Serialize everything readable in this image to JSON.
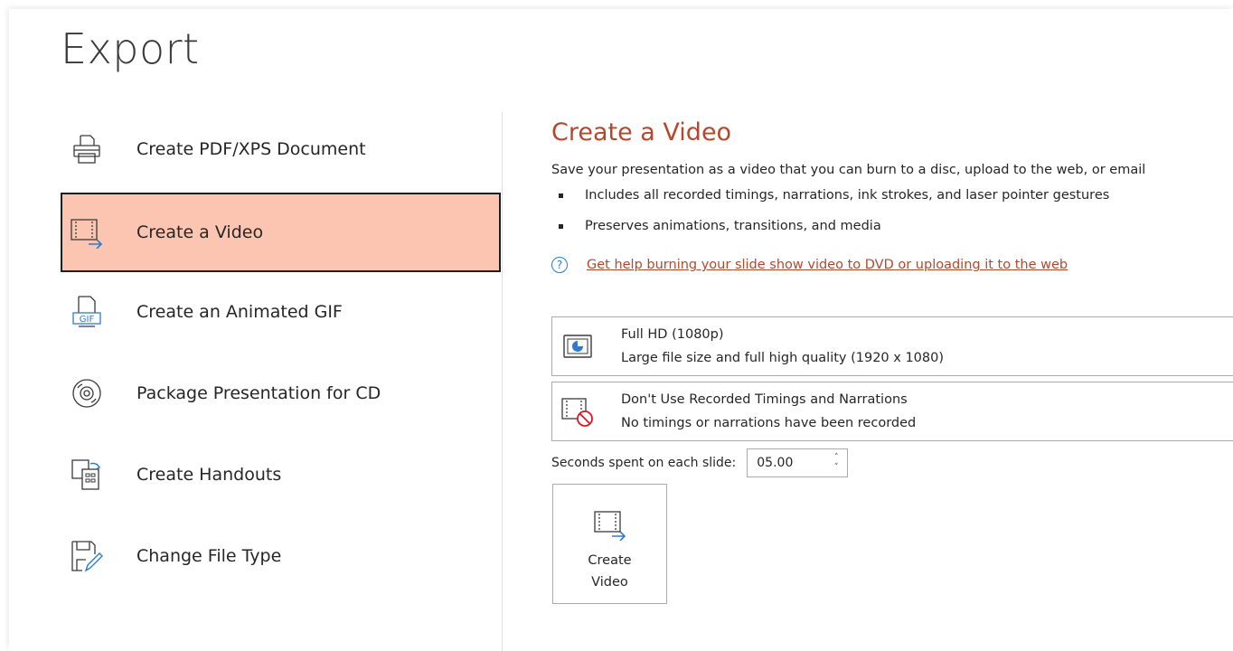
{
  "page_title": "Export",
  "nav": {
    "items": [
      {
        "label": "Create PDF/XPS Document",
        "icon": "pdf-document-icon"
      },
      {
        "label": "Create a Video",
        "icon": "video-export-icon",
        "selected": true
      },
      {
        "label": "Create an Animated GIF",
        "icon": "gif-icon"
      },
      {
        "label": "Package Presentation for CD",
        "icon": "cd-icon"
      },
      {
        "label": "Create Handouts",
        "icon": "handouts-icon"
      },
      {
        "label": "Change File Type",
        "icon": "change-file-type-icon"
      }
    ]
  },
  "panel": {
    "title": "Create a Video",
    "description": "Save your presentation as a video that you can burn to a disc, upload to the web, or email",
    "bullets": [
      "Includes all recorded timings, narrations, ink strokes, and laser pointer gestures",
      "Preserves animations, transitions, and media"
    ],
    "help_link": "Get help burning your slide show video to DVD or uploading it to the web",
    "quality_dropdown": {
      "title": "Full HD (1080p)",
      "subtitle": "Large file size and full high quality (1920 x 1080)"
    },
    "timings_dropdown": {
      "title": "Don't Use Recorded Timings and Narrations",
      "subtitle": "No timings or narrations have been recorded"
    },
    "seconds_label": "Seconds spent on each slide:",
    "seconds_value": "05.00",
    "create_button_label": "Create\nVideo"
  },
  "colors": {
    "accent": "#b7472a",
    "selected_bg": "#fcc5b2",
    "icon_blue": "#2b7cd3",
    "no_symbol_red": "#e81123"
  }
}
